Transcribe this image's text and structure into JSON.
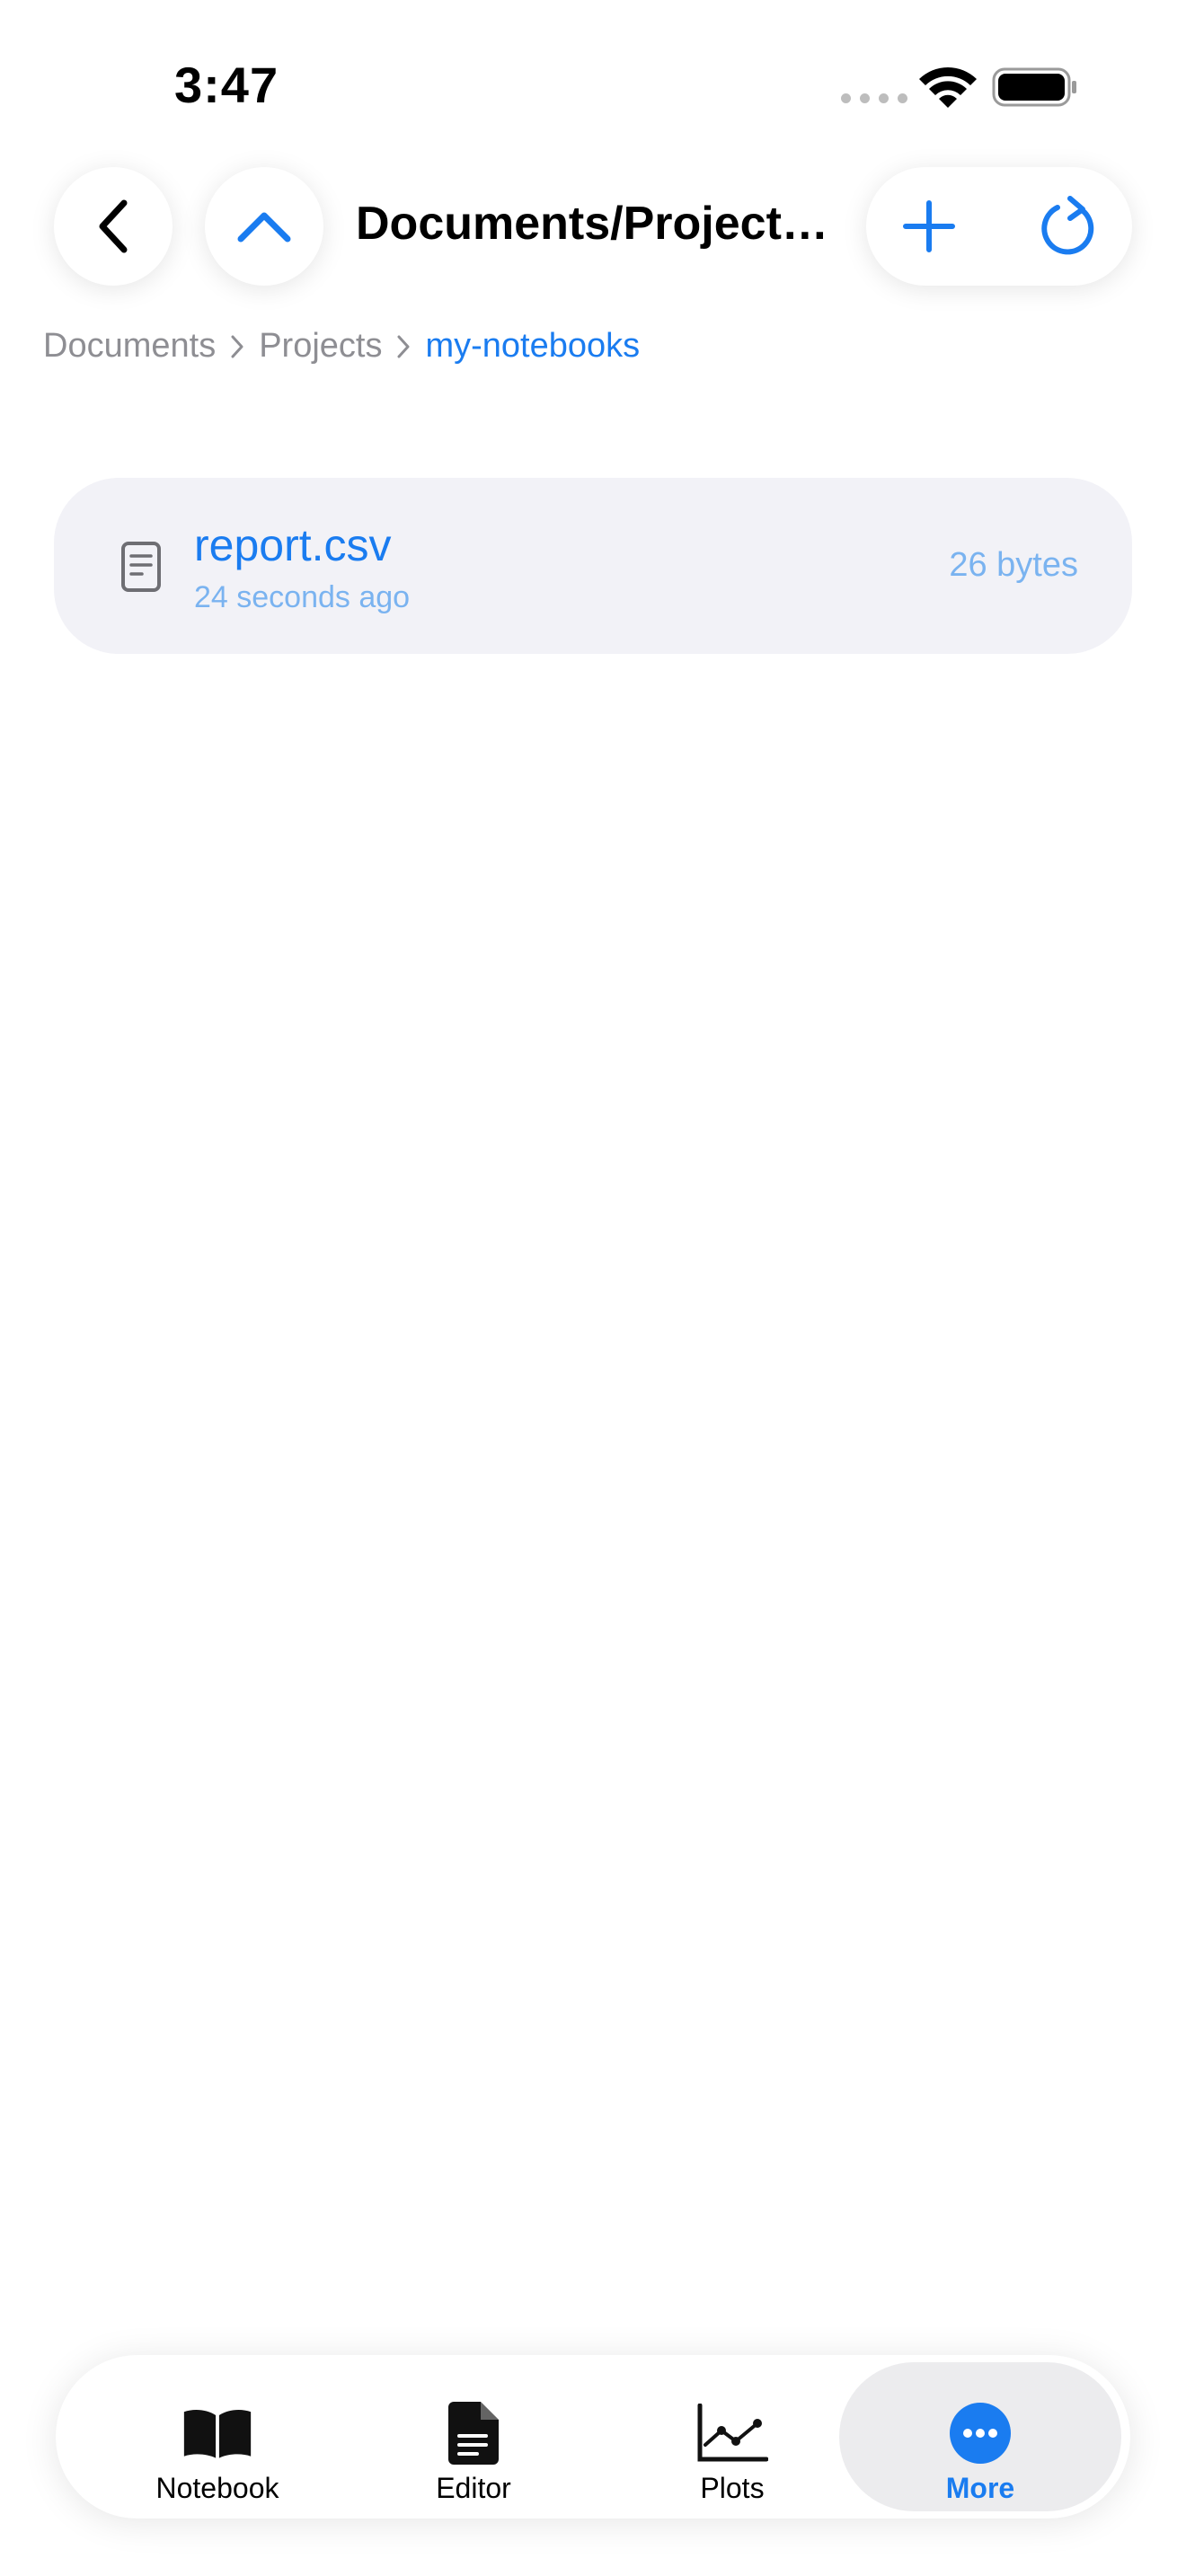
{
  "status_bar": {
    "time": "3:47"
  },
  "nav": {
    "title": "Documents/Projects..."
  },
  "breadcrumb": {
    "items": [
      "Documents",
      "Projects",
      "my-notebooks"
    ]
  },
  "files": [
    {
      "name": "report.csv",
      "modified": "24 seconds ago",
      "size": "26 bytes"
    }
  ],
  "tabs": [
    {
      "label": "Notebook",
      "icon": "book-icon"
    },
    {
      "label": "Editor",
      "icon": "document-icon"
    },
    {
      "label": "Plots",
      "icon": "chart-line-icon"
    },
    {
      "label": "More",
      "icon": "ellipsis-circle-icon",
      "selected": true
    }
  ],
  "colors": {
    "accent": "#1a7cf0",
    "secondary_text": "#8e8e93",
    "row_background": "#f2f2f7"
  }
}
